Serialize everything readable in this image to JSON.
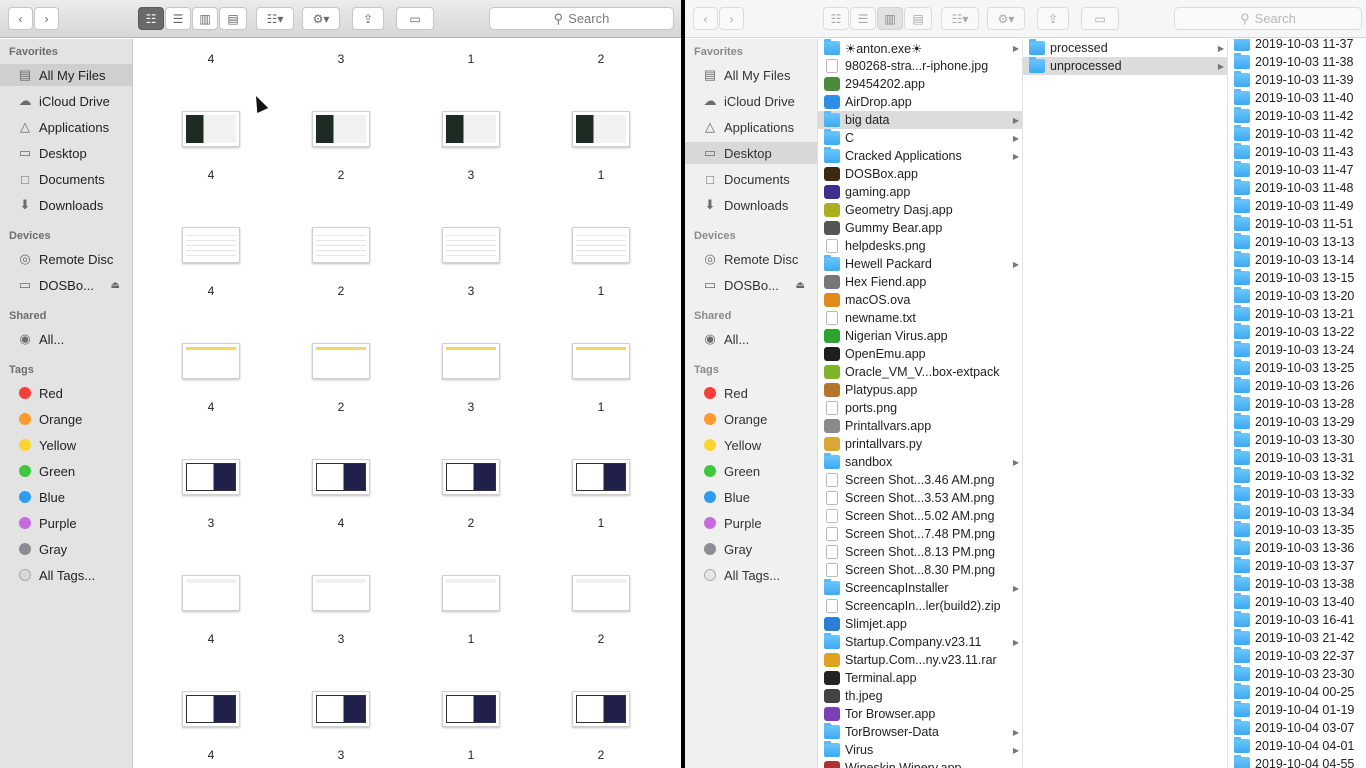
{
  "left_window": {
    "toolbar": {
      "search_label": "Search"
    },
    "sidebar": {
      "favorites_header": "Favorites",
      "favorites": [
        {
          "label": "All My Files",
          "icon": "all-files-icon",
          "selected": true
        },
        {
          "label": "iCloud Drive",
          "icon": "cloud-icon"
        },
        {
          "label": "Applications",
          "icon": "applications-icon"
        },
        {
          "label": "Desktop",
          "icon": "desktop-icon"
        },
        {
          "label": "Documents",
          "icon": "documents-icon"
        },
        {
          "label": "Downloads",
          "icon": "downloads-icon"
        }
      ],
      "devices_header": "Devices",
      "devices": [
        {
          "label": "Remote Disc",
          "icon": "disc-icon"
        },
        {
          "label": "DOSBo...",
          "icon": "drive-icon",
          "eject": true
        }
      ],
      "shared_header": "Shared",
      "shared": [
        {
          "label": "All...",
          "icon": "network-icon"
        }
      ],
      "tags_header": "Tags",
      "tags": [
        {
          "label": "Red",
          "color": "#fb3d37"
        },
        {
          "label": "Orange",
          "color": "#fd9a2b"
        },
        {
          "label": "Yellow",
          "color": "#fcd42f"
        },
        {
          "label": "Green",
          "color": "#3cc93c"
        },
        {
          "label": "Blue",
          "color": "#2f9cf3"
        },
        {
          "label": "Purple",
          "color": "#c76ae0"
        },
        {
          "label": "Gray",
          "color": "#8e8e92"
        },
        {
          "label": "All Tags...",
          "color": "#d9d9d9"
        }
      ]
    },
    "grid_top_labels": [
      "4",
      "3",
      "1",
      "2"
    ],
    "grid_rows": [
      {
        "labels": [
          "4",
          "2",
          "3",
          "1"
        ],
        "style": "dark-green"
      },
      {
        "labels": [
          "4",
          "2",
          "3",
          "1"
        ],
        "style": "doc-red"
      },
      {
        "labels": [
          "4",
          "2",
          "3",
          "1"
        ],
        "style": "doc-yellow"
      },
      {
        "labels": [
          "3",
          "4",
          "2",
          "1"
        ],
        "style": "dark-screen"
      },
      {
        "labels": [
          "4",
          "3",
          "1",
          "2"
        ],
        "style": "white-screen"
      },
      {
        "labels": [
          "4",
          "3",
          "1",
          "2"
        ],
        "style": "dark-screen"
      }
    ]
  },
  "right_window": {
    "toolbar": {
      "search_label": "Search"
    },
    "sidebar": {
      "favorites_header": "Favorites",
      "favorites": [
        {
          "label": "All My Files",
          "icon": "all-files-icon"
        },
        {
          "label": "iCloud Drive",
          "icon": "cloud-icon"
        },
        {
          "label": "Applications",
          "icon": "applications-icon"
        },
        {
          "label": "Desktop",
          "icon": "desktop-icon",
          "selected": true
        },
        {
          "label": "Documents",
          "icon": "documents-icon"
        },
        {
          "label": "Downloads",
          "icon": "downloads-icon"
        }
      ],
      "devices_header": "Devices",
      "devices": [
        {
          "label": "Remote Disc",
          "icon": "disc-icon"
        },
        {
          "label": "DOSBo...",
          "icon": "drive-icon",
          "eject": true
        }
      ],
      "shared_header": "Shared",
      "shared": [
        {
          "label": "All...",
          "icon": "network-icon"
        }
      ],
      "tags_header": "Tags",
      "tags": [
        {
          "label": "Red",
          "color": "#fb3d37"
        },
        {
          "label": "Orange",
          "color": "#fd9a2b"
        },
        {
          "label": "Yellow",
          "color": "#fcd42f"
        },
        {
          "label": "Green",
          "color": "#3cc93c"
        },
        {
          "label": "Blue",
          "color": "#2f9cf3"
        },
        {
          "label": "Purple",
          "color": "#c76ae0"
        },
        {
          "label": "Gray",
          "color": "#8e8e92"
        },
        {
          "label": "All Tags...",
          "color": "#e6e6e6"
        }
      ]
    },
    "column1": [
      {
        "name": "☀anton.exe☀",
        "kind": "folder",
        "arrow": true
      },
      {
        "name": "980268-stra...r-iphone.jpg",
        "kind": "file"
      },
      {
        "name": "29454202.app",
        "kind": "app",
        "color": "#4a8c3a"
      },
      {
        "name": "AirDrop.app",
        "kind": "app",
        "color": "#2e8ee8"
      },
      {
        "name": "big data",
        "kind": "folder",
        "arrow": true,
        "selected": true
      },
      {
        "name": "C",
        "kind": "folder",
        "arrow": true
      },
      {
        "name": "Cracked Applications",
        "kind": "folder",
        "arrow": true
      },
      {
        "name": "DOSBox.app",
        "kind": "app",
        "color": "#3a2a10"
      },
      {
        "name": "gaming.app",
        "kind": "app",
        "color": "#3b2f8f"
      },
      {
        "name": "Geometry Dasj.app",
        "kind": "app",
        "color": "#a8b11c"
      },
      {
        "name": "Gummy Bear.app",
        "kind": "app",
        "color": "#555555"
      },
      {
        "name": "helpdesks.png",
        "kind": "file"
      },
      {
        "name": "Hewell Packard",
        "kind": "folder",
        "arrow": true
      },
      {
        "name": "Hex Fiend.app",
        "kind": "app",
        "color": "#777777"
      },
      {
        "name": "macOS.ova",
        "kind": "app",
        "color": "#e08a1d"
      },
      {
        "name": "newname.txt",
        "kind": "file"
      },
      {
        "name": "Nigerian Virus.app",
        "kind": "app",
        "color": "#2fa32f"
      },
      {
        "name": "OpenEmu.app",
        "kind": "app",
        "color": "#1e1e1e"
      },
      {
        "name": "Oracle_VM_V...box-extpack",
        "kind": "app",
        "color": "#7fb32a"
      },
      {
        "name": "Platypus.app",
        "kind": "app",
        "color": "#b5762b"
      },
      {
        "name": "ports.png",
        "kind": "file"
      },
      {
        "name": "Printallvars.app",
        "kind": "app",
        "color": "#8a8a8a"
      },
      {
        "name": "printallvars.py",
        "kind": "app",
        "color": "#d9a63a"
      },
      {
        "name": "sandbox",
        "kind": "folder",
        "arrow": true
      },
      {
        "name": "Screen Shot...3.46 AM.png",
        "kind": "file"
      },
      {
        "name": "Screen Shot...3.53 AM.png",
        "kind": "file"
      },
      {
        "name": "Screen Shot...5.02 AM.png",
        "kind": "file"
      },
      {
        "name": "Screen Shot...7.48 PM.png",
        "kind": "file"
      },
      {
        "name": "Screen Shot...8.13 PM.png",
        "kind": "file"
      },
      {
        "name": "Screen Shot...8.30 PM.png",
        "kind": "file"
      },
      {
        "name": "ScreencapInstaller",
        "kind": "folder",
        "arrow": true
      },
      {
        "name": "ScreencapIn...ler(build2).zip",
        "kind": "file"
      },
      {
        "name": "Slimjet.app",
        "kind": "app",
        "color": "#2a7fd4"
      },
      {
        "name": "Startup.Company.v23.11",
        "kind": "folder",
        "arrow": true
      },
      {
        "name": "Startup.Com...ny.v23.11.rar",
        "kind": "app",
        "color": "#e0a020"
      },
      {
        "name": "Terminal.app",
        "kind": "app",
        "color": "#222222"
      },
      {
        "name": "th.jpeg",
        "kind": "app",
        "color": "#444444"
      },
      {
        "name": "Tor Browser.app",
        "kind": "app",
        "color": "#7a3fb5"
      },
      {
        "name": "TorBrowser-Data",
        "kind": "folder",
        "arrow": true
      },
      {
        "name": "Virus",
        "kind": "folder",
        "arrow": true
      },
      {
        "name": "Wineskin Winery.app",
        "kind": "app",
        "color": "#a33"
      }
    ],
    "column2": [
      {
        "name": "processed",
        "kind": "folder",
        "arrow": true
      },
      {
        "name": "unprocessed",
        "kind": "folder",
        "arrow": true,
        "selected": true
      }
    ],
    "column3": [
      "2019-10-03 11-37",
      "2019-10-03 11-38",
      "2019-10-03 11-39",
      "2019-10-03 11-40",
      "2019-10-03 11-42",
      "2019-10-03 11-42",
      "2019-10-03 11-43",
      "2019-10-03 11-47",
      "2019-10-03 11-48",
      "2019-10-03 11-49",
      "2019-10-03 11-51",
      "2019-10-03 13-13",
      "2019-10-03 13-14",
      "2019-10-03 13-15",
      "2019-10-03 13-20",
      "2019-10-03 13-21",
      "2019-10-03 13-22",
      "2019-10-03 13-24",
      "2019-10-03 13-25",
      "2019-10-03 13-26",
      "2019-10-03 13-28",
      "2019-10-03 13-29",
      "2019-10-03 13-30",
      "2019-10-03 13-31",
      "2019-10-03 13-32",
      "2019-10-03 13-33",
      "2019-10-03 13-34",
      "2019-10-03 13-35",
      "2019-10-03 13-36",
      "2019-10-03 13-37",
      "2019-10-03 13-38",
      "2019-10-03 13-40",
      "2019-10-03 16-41",
      "2019-10-03 21-42",
      "2019-10-03 22-37",
      "2019-10-03 23-30",
      "2019-10-04 00-25",
      "2019-10-04 01-19",
      "2019-10-04 03-07",
      "2019-10-04 04-01",
      "2019-10-04 04-55"
    ]
  }
}
